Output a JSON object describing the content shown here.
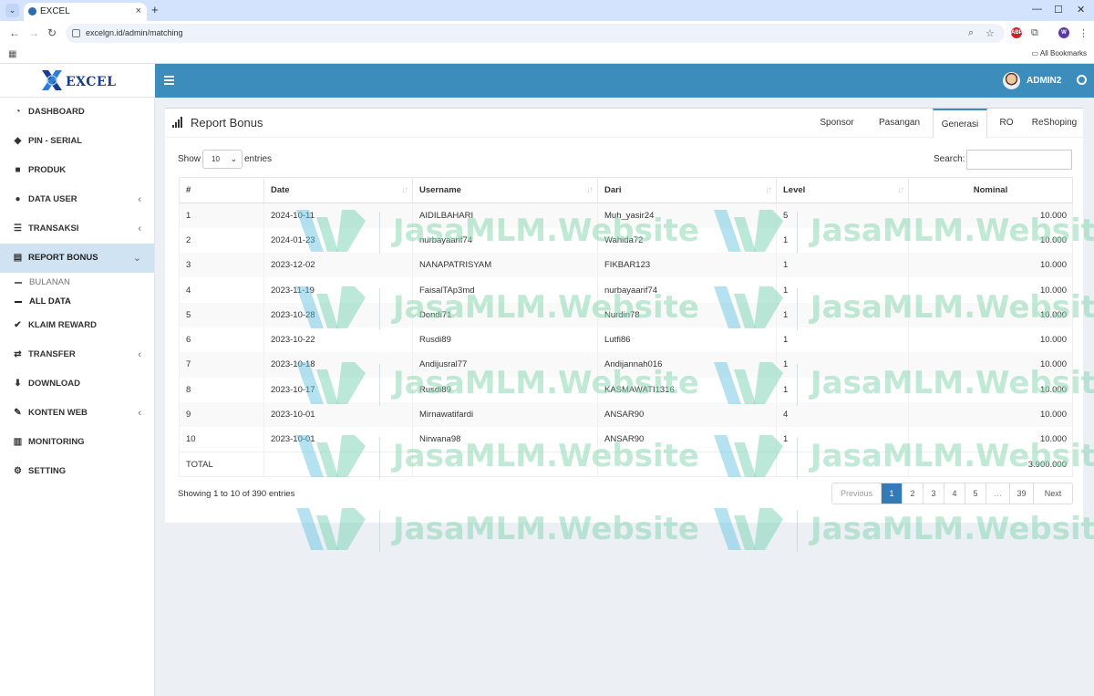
{
  "browser": {
    "tab_title": "EXCEL",
    "url": "excelgn.id/admin/matching",
    "bookmarks_label": "All Bookmarks"
  },
  "app": {
    "logo_text": "EXCEL",
    "user_name": "ADMIN2"
  },
  "sidebar": {
    "items": [
      {
        "label": "DASHBOARD",
        "icon": "dashboard-icon"
      },
      {
        "label": "PIN - SERIAL",
        "icon": "tag-icon"
      },
      {
        "label": "PRODUK",
        "icon": "cube-icon"
      },
      {
        "label": "DATA USER",
        "icon": "users-icon"
      },
      {
        "label": "TRANSAKSI",
        "icon": "list-icon"
      },
      {
        "label": "REPORT BONUS",
        "icon": "report-icon"
      },
      {
        "label": "KLAIM REWARD",
        "icon": "check-icon"
      },
      {
        "label": "TRANSFER",
        "icon": "exchange-icon"
      },
      {
        "label": "DOWNLOAD",
        "icon": "download-icon"
      },
      {
        "label": "KONTEN WEB",
        "icon": "edit-icon"
      },
      {
        "label": "MONITORING",
        "icon": "chart-icon"
      },
      {
        "label": "SETTING",
        "icon": "cogs-icon"
      }
    ],
    "subitems": [
      "BULANAN",
      "ALL DATA"
    ]
  },
  "report": {
    "title": "Report Bonus",
    "tabs": [
      "Sponsor",
      "Pasangan",
      "Generasi",
      "RO",
      "ReShoping"
    ],
    "active_tab": "Generasi",
    "show_label": "Show",
    "entries_value": "10",
    "entries_label": "entries",
    "search_label": "Search:",
    "columns": [
      "#",
      "Date",
      "Username",
      "Dari",
      "Level",
      "Nominal"
    ],
    "rows": [
      [
        "1",
        "2024-10-11",
        "AIDILBAHARI",
        "Muh_yasir24",
        "5",
        "10.000"
      ],
      [
        "2",
        "2024-01-23",
        "nurbayaarif74",
        "Wahida72",
        "1",
        "10.000"
      ],
      [
        "3",
        "2023-12-02",
        "NANAPATRISYAM",
        "FIKBAR123",
        "1",
        "10.000"
      ],
      [
        "4",
        "2023-11-19",
        "FaisalTAp3md",
        "nurbayaarif74",
        "1",
        "10.000"
      ],
      [
        "5",
        "2023-10-28",
        "Dondi71",
        "Nurdin78",
        "1",
        "10.000"
      ],
      [
        "6",
        "2023-10-22",
        "Rusdi89",
        "Lutfi86",
        "1",
        "10.000"
      ],
      [
        "7",
        "2023-10-18",
        "Andijusral77",
        "Andijannah016",
        "1",
        "10.000"
      ],
      [
        "8",
        "2023-10-17",
        "Rusdi89",
        "KASMAWATI1316",
        "1",
        "10.000"
      ],
      [
        "9",
        "2023-10-01",
        "Mirnawatifardi",
        "ANSAR90",
        "4",
        "10.000"
      ],
      [
        "10",
        "2023-10-01",
        "Nirwana98",
        "ANSAR90",
        "1",
        "10.000"
      ]
    ],
    "total_label": "TOTAL",
    "total_value": "3.900.000",
    "info": "Showing 1 to 10 of 390 entries",
    "pager": [
      "Previous",
      "1",
      "2",
      "3",
      "4",
      "5",
      "…",
      "39",
      "Next"
    ]
  },
  "watermark": "JasaMLM.Website"
}
